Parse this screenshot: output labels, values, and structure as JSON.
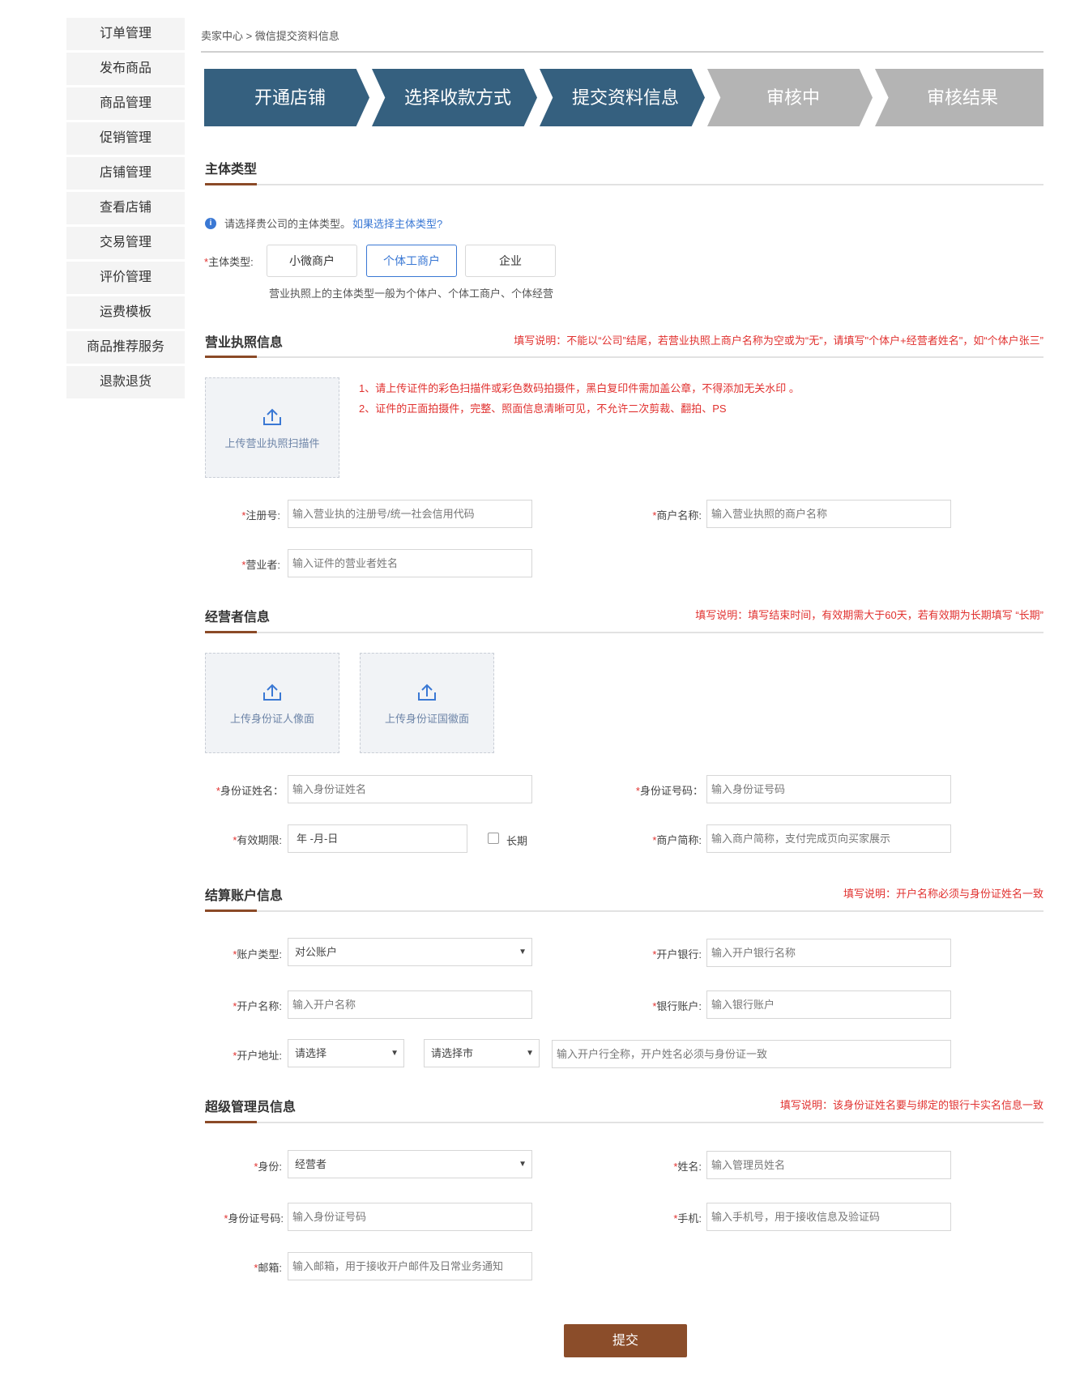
{
  "sidebar": {
    "items": [
      "订单管理",
      "发布商品",
      "商品管理",
      "促销管理",
      "店铺管理",
      "查看店铺",
      "交易管理",
      "评价管理",
      "运费模板",
      "商品推荐服务",
      "退款退货"
    ]
  },
  "breadcrumb": "卖家中心 > 微信提交资料信息",
  "steps": [
    "开通店铺",
    "选择收款方式",
    "提交资料信息",
    "审核中",
    "审核结果"
  ],
  "subject": {
    "title": "主体类型",
    "info": "请选择贵公司的主体类型。",
    "info_link": "如果选择主体类型?",
    "label": "主体类型:",
    "options": [
      "小微商户",
      "个体工商户",
      "企业"
    ],
    "hint": "营业执照上的主体类型一般为个体户、个体工商户、个体经营"
  },
  "license": {
    "title": "营业执照信息",
    "note": "填写说明：不能以“公司”结尾，若营业执照上商户名称为空或为“无”，请填写\"个体户+经营者姓名\"，如“个体户张三”",
    "upload_label": "上传营业执照扫描件",
    "req1": "1、请上传证件的彩色扫描件或彩色数码拍摄件，黑白复印件需加盖公章，不得添加无关水印 。",
    "req2": "2、证件的正面拍摄件，完整、照面信息清晰可见，不允许二次剪裁、翻拍、PS",
    "reg_label": "注册号:",
    "reg_ph": "输入营业执的注册号/统一社会信用代码",
    "name_label": "商户名称:",
    "name_ph": "输入营业执照的商户名称",
    "op_label": "营业者:",
    "op_ph": "输入证件的营业者姓名"
  },
  "operator": {
    "title": "经营者信息",
    "note": "填写说明：填写结束时间，有效期需大于60天，若有效期为长期填写 “长期”",
    "upload_front": "上传身份证人像面",
    "upload_back": "上传身份证国徽面",
    "idname_label": "身份证姓名：",
    "idname_ph": "输入身份证姓名",
    "idno_label": "身份证号码：",
    "idno_ph": "输入身份证号码",
    "valid_label": "有效期限:",
    "valid_ph": "年 -月-日",
    "long_label": "长期",
    "short_label": "商户简称:",
    "short_ph": "输入商户简称，支付完成页向买家展示"
  },
  "settle": {
    "title": "结算账户信息",
    "note": "填写说明：开户名称必须与身份证姓名一致",
    "acct_type_label": "账户类型:",
    "acct_type_val": "对公账户",
    "bank_label": "开户银行:",
    "bank_ph": "输入开户银行名称",
    "acct_name_label": "开户名称:",
    "acct_name_ph": "输入开户名称",
    "acct_no_label": "银行账户:",
    "acct_no_ph": "输入银行账户",
    "addr_label": "开户地址:",
    "prov_val": "请选择",
    "city_val": "请选择市",
    "addr_ph": "输入开户行全称，开户姓名必须与身份证一致"
  },
  "admin": {
    "title": "超级管理员信息",
    "note": "填写说明：该身份证姓名要与绑定的银行卡实名信息一致",
    "role_label": "身份:",
    "role_val": "经营者",
    "name_label": "姓名:",
    "name_ph": "输入管理员姓名",
    "id_label": "身份证号码:",
    "id_ph": "输入身份证号码",
    "phone_label": "手机:",
    "phone_ph": "输入手机号，用于接收信息及验证码",
    "email_label": "邮箱:",
    "email_ph": "输入邮箱，用于接收开户邮件及日常业务通知"
  },
  "submit_label": "提交"
}
